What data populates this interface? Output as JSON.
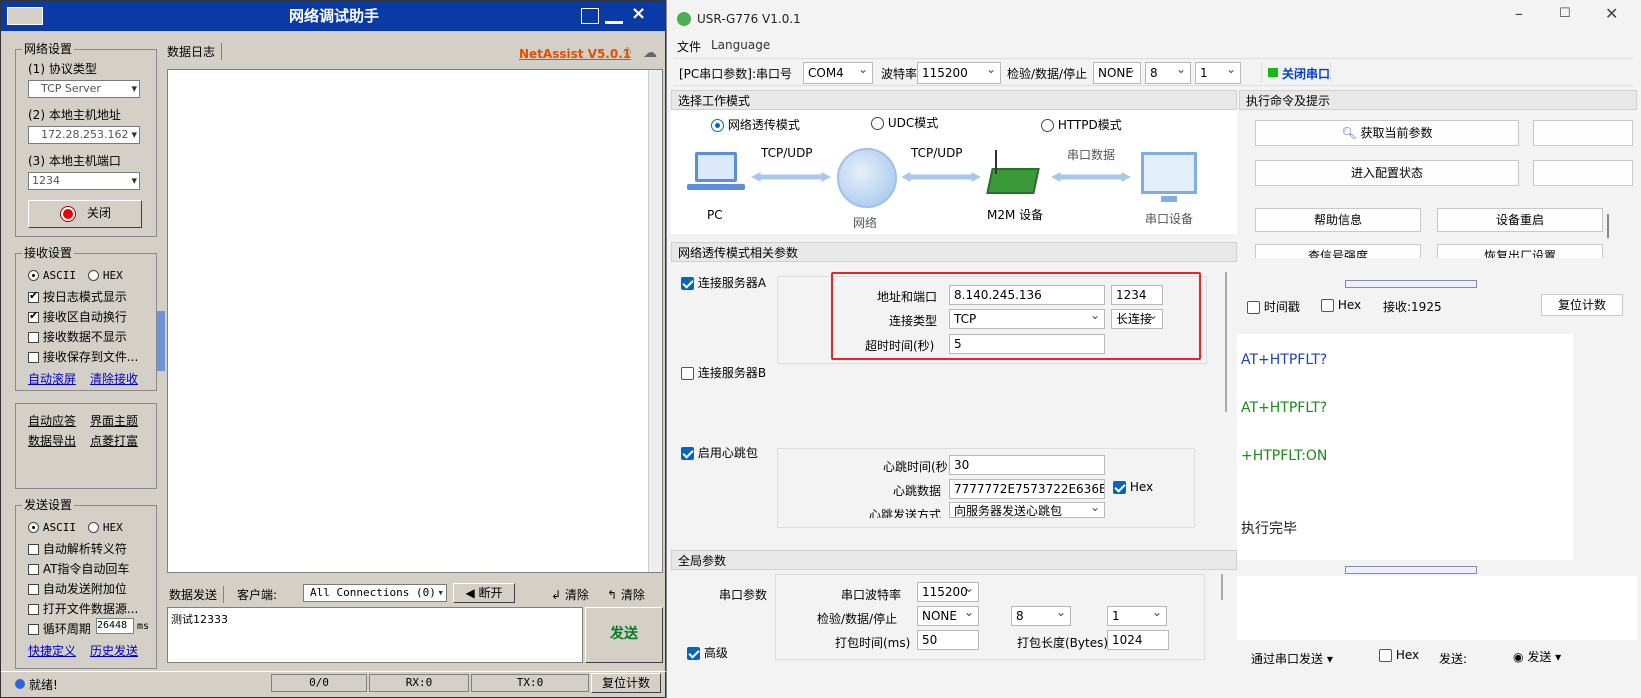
{
  "left_app": {
    "title": "网络调试助手",
    "brand": "NetAssist V5.0.1",
    "net_settings": {
      "label": "网络设置",
      "protocol_label": "(1) 协议类型",
      "protocol_value": "TCP Server",
      "host_label": "(2) 本地主机地址",
      "host_value": "172.28.253.162",
      "port_label": "(3) 本地主机端口",
      "port_value": "1234",
      "close_button": "关闭"
    },
    "recv_settings": {
      "label": "接收设置",
      "ascii": "ASCII",
      "hex": "HEX",
      "opt_log": "按日志模式显示",
      "opt_wrap": "接收区自动换行",
      "opt_hide": "接收数据不显示",
      "opt_save": "接收保存到文件...",
      "link_scroll": "自动滚屏",
      "link_clear": "清除接收"
    },
    "tools": {
      "auto_reply": "自动应答",
      "theme": "界面主题",
      "export": "数据导出",
      "print": "点菱打富"
    },
    "send_settings": {
      "label": "发送设置",
      "ascii": "ASCII",
      "hex": "HEX",
      "opt_escape": "自动解析转义符",
      "opt_at": "AT指令自动回车",
      "opt_checksum": "自动发送附加位",
      "opt_file": "打开文件数据源...",
      "opt_cycle": "循环周期",
      "cycle_value": "26448",
      "cycle_unit": "ms",
      "link_shortcut": "快捷定义",
      "link_history": "历史发送"
    },
    "log_tab": "数据日志",
    "send_bar": {
      "tab": "数据发送",
      "client_label": "客户端:",
      "client_value": "All Connections (0)",
      "disconnect": "断开",
      "clear1": "清除",
      "clear2": "清除"
    },
    "send_text": "测试12333",
    "send_button": "发送",
    "status": {
      "ready": "就绪!",
      "count": "0/0",
      "rx": "RX:0",
      "tx": "TX:0",
      "reset": "复位计数"
    }
  },
  "right_app": {
    "title": "USR-G776 V1.0.1",
    "menu": [
      "文件",
      "Language"
    ],
    "toolbar": {
      "pc_param": "[PC串口参数]",
      "port_label": ":串口号",
      "port": "COM4",
      "baud_label": "波特率",
      "baud": "115200",
      "parity_label": "检验/数据/停止",
      "parity": "NONE",
      "databits": "8",
      "stopbits": "1",
      "close_port": "关闭串口"
    },
    "mode": {
      "section": "选择工作模式",
      "opt_net": "网络透传模式",
      "opt_udc": "UDC模式",
      "opt_httpd": "HTTPD模式",
      "diagram": {
        "pc": "PC",
        "tcpudp1": "TCP/UDP",
        "network": "网络",
        "tcpudp2": "TCP/UDP",
        "m2m": "M2M 设备",
        "serial_data": "串口数据",
        "serial_dev": "串口设备"
      }
    },
    "net_params": {
      "section": "网络透传模式相关参数",
      "serverA": "连接服务器A",
      "addr_label": "地址和端口",
      "addr": "8.140.245.136",
      "port": "1234",
      "conn_type_label": "连接类型",
      "conn_type": "TCP",
      "conn_mode": "长连接",
      "timeout_label": "超时时间(秒)",
      "timeout": "5",
      "serverB": "连接服务器B",
      "heartbeat": "启用心跳包",
      "hb_time_label": "心跳时间(秒",
      "hb_time": "30",
      "hb_data_label": "心跳数据",
      "hb_data": "7777772E7573722E636E",
      "hb_hex": "Hex",
      "hb_mode_label": "心跳发送方式",
      "hb_mode": "向服务器发送心跳包"
    },
    "global": {
      "section": "全局参数",
      "serial_label": "串口参数",
      "baud_label": "串口波特率",
      "baud": "115200",
      "parity_label": "检验/数据/停止",
      "parity": "NONE",
      "databits": "8",
      "stopbits": "1",
      "pack_time_label": "打包时间(ms)",
      "pack_time": "50",
      "pack_len_label": "打包长度(Bytes)",
      "pack_len": "1024",
      "advanced": "高级"
    },
    "cmd": {
      "section": "执行命令及提示",
      "get_params": "获取当前参数",
      "enter_config": "进入配置状态",
      "help": "帮助信息",
      "restart": "设备重启",
      "signal": "查信号强度",
      "factory": "恢复出厂设置",
      "timestamp": "时间戳",
      "hex": "Hex",
      "recv": "接收:1925",
      "reset_count": "复位计数",
      "log": [
        {
          "text": "AT+HTPFLT?",
          "color": "#1e40c8"
        },
        {
          "text": "AT+HTPFLT?",
          "color": "#1a8a1a"
        },
        {
          "text": "+HTPFLT:ON",
          "color": "#1a8a1a"
        },
        {
          "text": "执行完毕",
          "color": "#222222"
        }
      ],
      "send_via": "通过串口发送",
      "send_hex": "Hex",
      "send_label": "发送:",
      "send_button": "发送"
    }
  }
}
